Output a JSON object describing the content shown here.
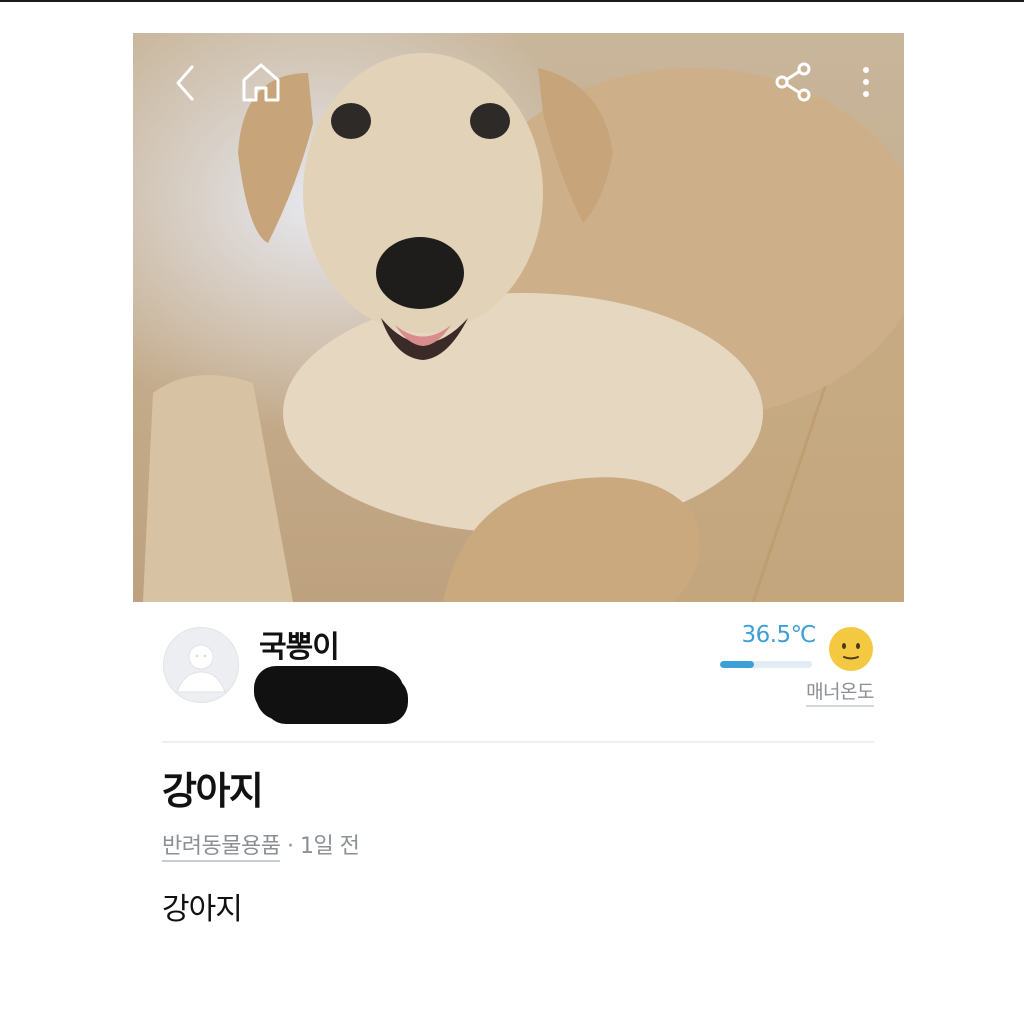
{
  "header": {
    "back_icon": "chevron-left-icon",
    "home_icon": "home-icon",
    "share_icon": "share-icon",
    "more_icon": "more-vertical-icon"
  },
  "seller": {
    "name": "국뽕이",
    "region": "",
    "manner_temperature": "36.5℃",
    "manner_temperature_value": 36.5,
    "manner_label": "매너온도",
    "face_icon": "smiley-face-icon"
  },
  "listing": {
    "title": "강아지",
    "category": "반려동물용품",
    "separator": "·",
    "time": "1일 전",
    "description": "강아지"
  },
  "colors": {
    "accent_blue": "#3d9fd8",
    "face_yellow": "#f5c842",
    "muted_text": "#8b8f96"
  }
}
